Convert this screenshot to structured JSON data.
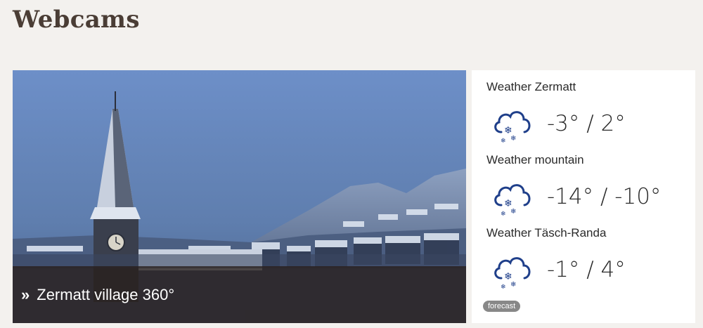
{
  "page": {
    "title": "Webcams"
  },
  "webcam": {
    "caption": "Zermatt village 360°",
    "caption_arrow": "»"
  },
  "weather": {
    "locations": [
      {
        "name": "Weather Zermatt",
        "temperature": "-3° / 2°",
        "icon": "snow-cloud-icon"
      },
      {
        "name": "Weather mountain",
        "temperature": "-14° / -10°",
        "icon": "snow-cloud-icon"
      },
      {
        "name": "Weather Täsch-Randa",
        "temperature": "-1° / 4°",
        "icon": "snow-cloud-icon"
      }
    ],
    "forecast_label": "forecast"
  },
  "colors": {
    "title": "#4a3d35",
    "icon": "#1f3f8a",
    "background": "#f3f1ee",
    "badge": "#888888"
  }
}
